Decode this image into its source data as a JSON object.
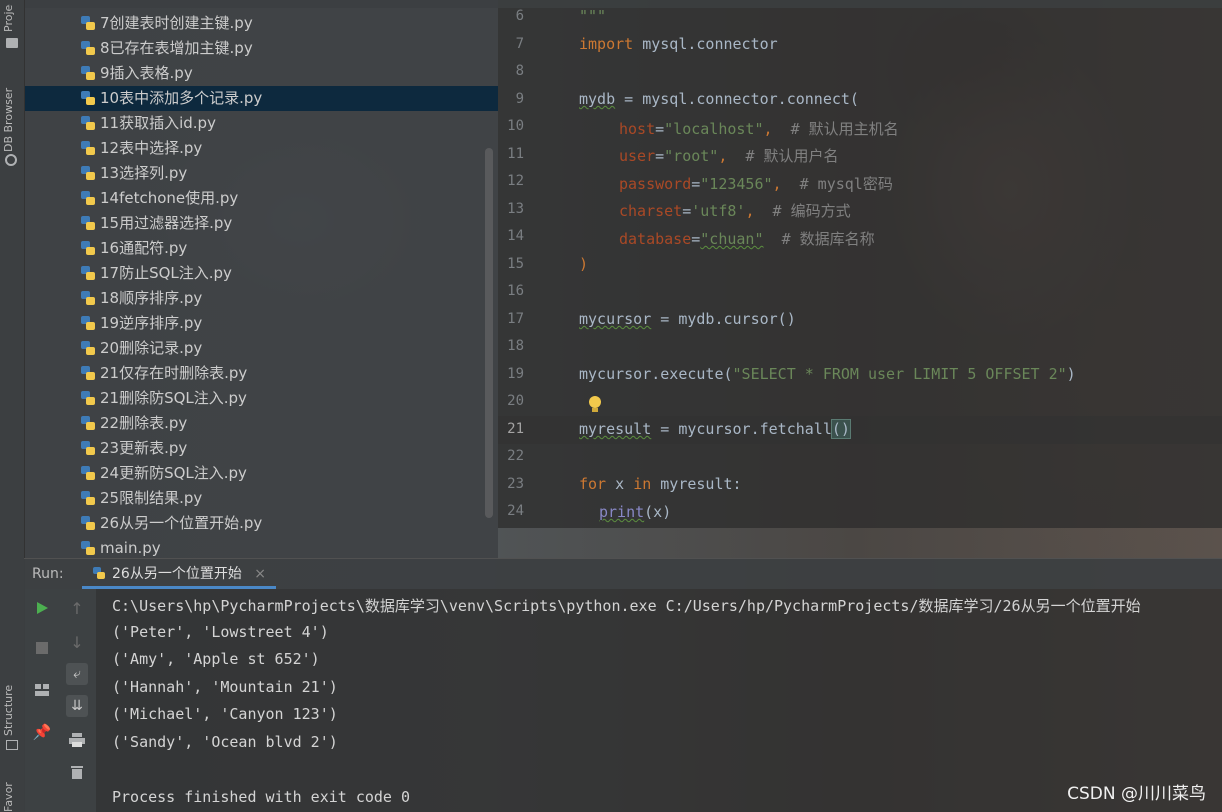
{
  "side_tabs": {
    "project": "Project",
    "db_browser": "DB Browser",
    "structure": "Structure",
    "favorites": "Favorites"
  },
  "files": [
    "7创建表时创建主键.py",
    "8已存在表增加主键.py",
    "9插入表格.py",
    "10表中添加多个记录.py",
    "11获取插入id.py",
    "12表中选择.py",
    "13选择列.py",
    "14fetchone使用.py",
    "15用过滤器选择.py",
    "16通配符.py",
    "17防止SQL注入.py",
    "18顺序排序.py",
    "19逆序排序.py",
    "20删除记录.py",
    "21仅存在时删除表.py",
    "21删除防SQL注入.py",
    "22删除表.py",
    "23更新表.py",
    "24更新防SQL注入.py",
    "25限制结果.py",
    "26从另一个位置开始.py",
    "main.py"
  ],
  "selected_file": "10表中添加多个记录.py",
  "editor": {
    "line_numbers": [
      "6",
      "7",
      "8",
      "9",
      "10",
      "11",
      "12",
      "13",
      "14",
      "15",
      "16",
      "17",
      "18",
      "19",
      "20",
      "21",
      "22",
      "23",
      "24"
    ],
    "current_line": "21",
    "lines": {
      "l6": "\"\"\"",
      "l7_kw": "import",
      "l7_rest": " mysql.connector",
      "l9_var": "mydb",
      "l9_rest": " = mysql.connector.connect(",
      "l10_param": "host",
      "l10_eq": "=",
      "l10_str": "\"localhost\"",
      "l10_sep": ",  ",
      "l10_cmt": "# 默认用主机名",
      "l11_param": "user",
      "l11_eq": "=",
      "l11_str": "\"root\"",
      "l11_sep": ",  ",
      "l11_cmt": "# 默认用户名",
      "l12_param": "password",
      "l12_eq": "=",
      "l12_str": "\"123456\"",
      "l12_sep": ",  ",
      "l12_cmt": "# mysql密码",
      "l13_param": "charset",
      "l13_eq": "=",
      "l13_str": "'utf8'",
      "l13_sep": ",  ",
      "l13_cmt": "# 编码方式",
      "l14_param": "database",
      "l14_eq": "=",
      "l14_str": "\"chuan\"",
      "l14_sep": "  ",
      "l14_cmt": "# 数据库名称",
      "l15": ")",
      "l17_var": "mycursor",
      "l17_rest": " = mydb.cursor()",
      "l19_pre": "mycursor.execute(",
      "l19_str": "\"SELECT * FROM user LIMIT 5 OFFSET 2\"",
      "l19_post": ")",
      "l21_var": "myresult",
      "l21_rest": " = mycursor.fetchall",
      "l21_paren": "()",
      "l23_for": "for",
      "l23_mid": " x ",
      "l23_in": "in",
      "l23_rest": " myresult:",
      "l24_fn": "print",
      "l24_rest": "(x)"
    }
  },
  "run": {
    "label": "Run:",
    "tab": "26从另一个位置开始",
    "output": [
      "C:\\Users\\hp\\PycharmProjects\\数据库学习\\venv\\Scripts\\python.exe C:/Users/hp/PycharmProjects/数据库学习/26从另一个位置开始",
      "('Peter', 'Lowstreet 4')",
      "('Amy', 'Apple st 652')",
      "('Hannah', 'Mountain 21')",
      "('Michael', 'Canyon 123')",
      "('Sandy', 'Ocean blvd 2')",
      "",
      "Process finished with exit code 0"
    ]
  },
  "watermark": "CSDN @川川菜鸟",
  "colors": {
    "keyword": "#cc7832",
    "string": "#6a8759",
    "param": "#aa4926",
    "comment": "#808080",
    "selection": "#0d293e",
    "run_green": "#4caf50"
  }
}
